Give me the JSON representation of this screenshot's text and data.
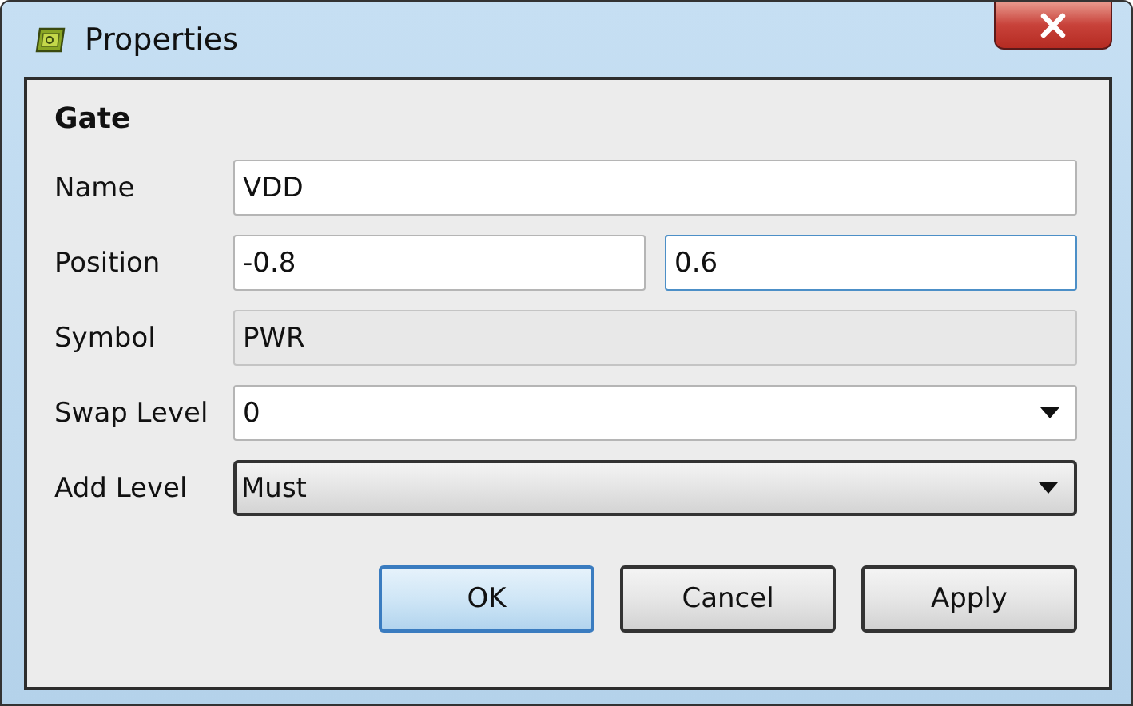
{
  "window": {
    "title": "Properties"
  },
  "section": "Gate",
  "fields": [
    {
      "kind": "text",
      "label": "Name",
      "value": "VDD"
    },
    {
      "kind": "pair",
      "label": "Position",
      "values": [
        {
          "value": "-0.8",
          "focused": false
        },
        {
          "value": "0.6",
          "focused": true
        }
      ]
    },
    {
      "kind": "readonly",
      "label": "Symbol",
      "value": "PWR"
    },
    {
      "kind": "combo",
      "label": "Swap Level",
      "value": "0"
    },
    {
      "kind": "dropdown",
      "label": "Add Level",
      "value": "Must"
    }
  ],
  "buttons": [
    {
      "label": "OK",
      "default": true
    },
    {
      "label": "Cancel",
      "default": false
    },
    {
      "label": "Apply",
      "default": false
    }
  ]
}
